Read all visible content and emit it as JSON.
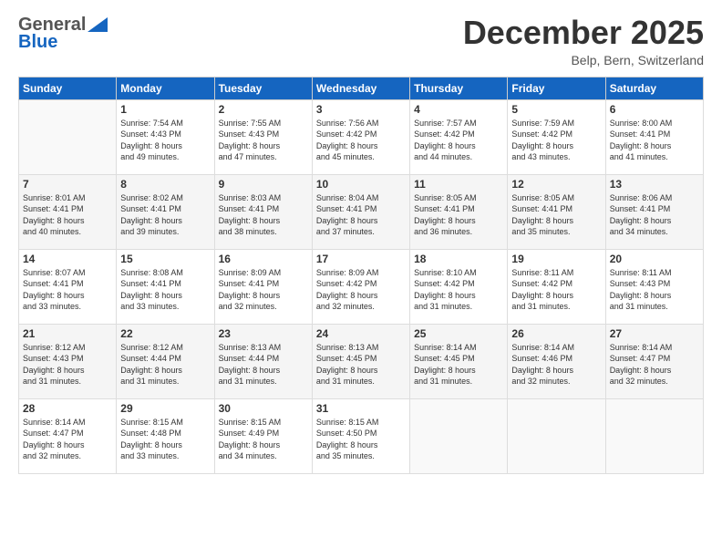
{
  "logo": {
    "general": "General",
    "blue": "Blue"
  },
  "header": {
    "month": "December 2025",
    "location": "Belp, Bern, Switzerland"
  },
  "weekdays": [
    "Sunday",
    "Monday",
    "Tuesday",
    "Wednesday",
    "Thursday",
    "Friday",
    "Saturday"
  ],
  "weeks": [
    [
      {
        "day": "",
        "sunrise": "",
        "sunset": "",
        "daylight": ""
      },
      {
        "day": "1",
        "sunrise": "Sunrise: 7:54 AM",
        "sunset": "Sunset: 4:43 PM",
        "daylight": "Daylight: 8 hours",
        "daylight2": "and 49 minutes."
      },
      {
        "day": "2",
        "sunrise": "Sunrise: 7:55 AM",
        "sunset": "Sunset: 4:43 PM",
        "daylight": "Daylight: 8 hours",
        "daylight2": "and 47 minutes."
      },
      {
        "day": "3",
        "sunrise": "Sunrise: 7:56 AM",
        "sunset": "Sunset: 4:42 PM",
        "daylight": "Daylight: 8 hours",
        "daylight2": "and 45 minutes."
      },
      {
        "day": "4",
        "sunrise": "Sunrise: 7:57 AM",
        "sunset": "Sunset: 4:42 PM",
        "daylight": "Daylight: 8 hours",
        "daylight2": "and 44 minutes."
      },
      {
        "day": "5",
        "sunrise": "Sunrise: 7:59 AM",
        "sunset": "Sunset: 4:42 PM",
        "daylight": "Daylight: 8 hours",
        "daylight2": "and 43 minutes."
      },
      {
        "day": "6",
        "sunrise": "Sunrise: 8:00 AM",
        "sunset": "Sunset: 4:41 PM",
        "daylight": "Daylight: 8 hours",
        "daylight2": "and 41 minutes."
      }
    ],
    [
      {
        "day": "7",
        "sunrise": "Sunrise: 8:01 AM",
        "sunset": "Sunset: 4:41 PM",
        "daylight": "Daylight: 8 hours",
        "daylight2": "and 40 minutes."
      },
      {
        "day": "8",
        "sunrise": "Sunrise: 8:02 AM",
        "sunset": "Sunset: 4:41 PM",
        "daylight": "Daylight: 8 hours",
        "daylight2": "and 39 minutes."
      },
      {
        "day": "9",
        "sunrise": "Sunrise: 8:03 AM",
        "sunset": "Sunset: 4:41 PM",
        "daylight": "Daylight: 8 hours",
        "daylight2": "and 38 minutes."
      },
      {
        "day": "10",
        "sunrise": "Sunrise: 8:04 AM",
        "sunset": "Sunset: 4:41 PM",
        "daylight": "Daylight: 8 hours",
        "daylight2": "and 37 minutes."
      },
      {
        "day": "11",
        "sunrise": "Sunrise: 8:05 AM",
        "sunset": "Sunset: 4:41 PM",
        "daylight": "Daylight: 8 hours",
        "daylight2": "and 36 minutes."
      },
      {
        "day": "12",
        "sunrise": "Sunrise: 8:05 AM",
        "sunset": "Sunset: 4:41 PM",
        "daylight": "Daylight: 8 hours",
        "daylight2": "and 35 minutes."
      },
      {
        "day": "13",
        "sunrise": "Sunrise: 8:06 AM",
        "sunset": "Sunset: 4:41 PM",
        "daylight": "Daylight: 8 hours",
        "daylight2": "and 34 minutes."
      }
    ],
    [
      {
        "day": "14",
        "sunrise": "Sunrise: 8:07 AM",
        "sunset": "Sunset: 4:41 PM",
        "daylight": "Daylight: 8 hours",
        "daylight2": "and 33 minutes."
      },
      {
        "day": "15",
        "sunrise": "Sunrise: 8:08 AM",
        "sunset": "Sunset: 4:41 PM",
        "daylight": "Daylight: 8 hours",
        "daylight2": "and 33 minutes."
      },
      {
        "day": "16",
        "sunrise": "Sunrise: 8:09 AM",
        "sunset": "Sunset: 4:41 PM",
        "daylight": "Daylight: 8 hours",
        "daylight2": "and 32 minutes."
      },
      {
        "day": "17",
        "sunrise": "Sunrise: 8:09 AM",
        "sunset": "Sunset: 4:42 PM",
        "daylight": "Daylight: 8 hours",
        "daylight2": "and 32 minutes."
      },
      {
        "day": "18",
        "sunrise": "Sunrise: 8:10 AM",
        "sunset": "Sunset: 4:42 PM",
        "daylight": "Daylight: 8 hours",
        "daylight2": "and 31 minutes."
      },
      {
        "day": "19",
        "sunrise": "Sunrise: 8:11 AM",
        "sunset": "Sunset: 4:42 PM",
        "daylight": "Daylight: 8 hours",
        "daylight2": "and 31 minutes."
      },
      {
        "day": "20",
        "sunrise": "Sunrise: 8:11 AM",
        "sunset": "Sunset: 4:43 PM",
        "daylight": "Daylight: 8 hours",
        "daylight2": "and 31 minutes."
      }
    ],
    [
      {
        "day": "21",
        "sunrise": "Sunrise: 8:12 AM",
        "sunset": "Sunset: 4:43 PM",
        "daylight": "Daylight: 8 hours",
        "daylight2": "and 31 minutes."
      },
      {
        "day": "22",
        "sunrise": "Sunrise: 8:12 AM",
        "sunset": "Sunset: 4:44 PM",
        "daylight": "Daylight: 8 hours",
        "daylight2": "and 31 minutes."
      },
      {
        "day": "23",
        "sunrise": "Sunrise: 8:13 AM",
        "sunset": "Sunset: 4:44 PM",
        "daylight": "Daylight: 8 hours",
        "daylight2": "and 31 minutes."
      },
      {
        "day": "24",
        "sunrise": "Sunrise: 8:13 AM",
        "sunset": "Sunset: 4:45 PM",
        "daylight": "Daylight: 8 hours",
        "daylight2": "and 31 minutes."
      },
      {
        "day": "25",
        "sunrise": "Sunrise: 8:14 AM",
        "sunset": "Sunset: 4:45 PM",
        "daylight": "Daylight: 8 hours",
        "daylight2": "and 31 minutes."
      },
      {
        "day": "26",
        "sunrise": "Sunrise: 8:14 AM",
        "sunset": "Sunset: 4:46 PM",
        "daylight": "Daylight: 8 hours",
        "daylight2": "and 32 minutes."
      },
      {
        "day": "27",
        "sunrise": "Sunrise: 8:14 AM",
        "sunset": "Sunset: 4:47 PM",
        "daylight": "Daylight: 8 hours",
        "daylight2": "and 32 minutes."
      }
    ],
    [
      {
        "day": "28",
        "sunrise": "Sunrise: 8:14 AM",
        "sunset": "Sunset: 4:47 PM",
        "daylight": "Daylight: 8 hours",
        "daylight2": "and 32 minutes."
      },
      {
        "day": "29",
        "sunrise": "Sunrise: 8:15 AM",
        "sunset": "Sunset: 4:48 PM",
        "daylight": "Daylight: 8 hours",
        "daylight2": "and 33 minutes."
      },
      {
        "day": "30",
        "sunrise": "Sunrise: 8:15 AM",
        "sunset": "Sunset: 4:49 PM",
        "daylight": "Daylight: 8 hours",
        "daylight2": "and 34 minutes."
      },
      {
        "day": "31",
        "sunrise": "Sunrise: 8:15 AM",
        "sunset": "Sunset: 4:50 PM",
        "daylight": "Daylight: 8 hours",
        "daylight2": "and 35 minutes."
      },
      {
        "day": "",
        "sunrise": "",
        "sunset": "",
        "daylight": ""
      },
      {
        "day": "",
        "sunrise": "",
        "sunset": "",
        "daylight": ""
      },
      {
        "day": "",
        "sunrise": "",
        "sunset": "",
        "daylight": ""
      }
    ]
  ]
}
